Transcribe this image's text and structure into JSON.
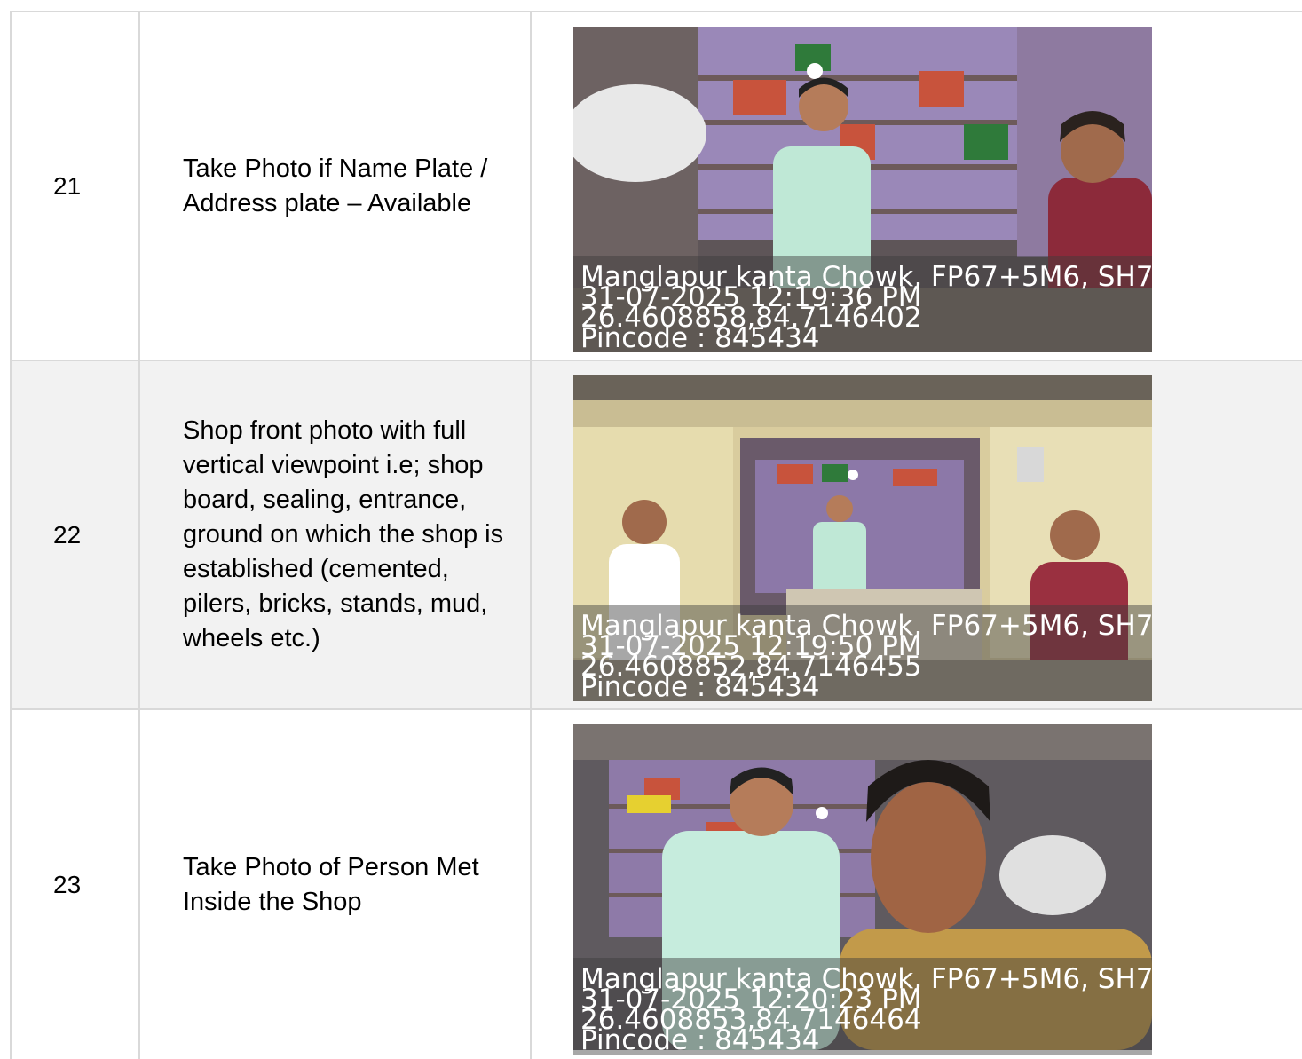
{
  "rows": [
    {
      "number": "21",
      "description": "Take Photo if Name Plate / Address plate – Available",
      "photo": {
        "stamp": [
          "Manglapur kanta Chowk, FP67+5M6, SH7",
          "31-07-2025 12:19:36 PM",
          "26.4608858,84.7146402",
          "Pincode : 845434"
        ]
      }
    },
    {
      "number": "22",
      "description": "Shop front photo with full vertical viewpoint i.e; shop board, sealing, entrance, ground on which the shop is established (cemented, pilers, bricks, stands, mud, wheels etc.)",
      "photo": {
        "stamp": [
          "Manglapur kanta Chowk, FP67+5M6, SH7",
          "31-07-2025 12:19:50 PM",
          "26.4608852,84.7146455",
          "Pincode : 845434"
        ]
      }
    },
    {
      "number": "23",
      "description": "Take Photo of Person Met Inside the Shop",
      "photo": {
        "stamp": [
          "Manglapur kanta Chowk, FP67+5M6, SH7",
          "31-07-2025 12:20:23 PM",
          "26.4608853,84.7146464",
          "Pincode : 845434"
        ]
      }
    }
  ]
}
